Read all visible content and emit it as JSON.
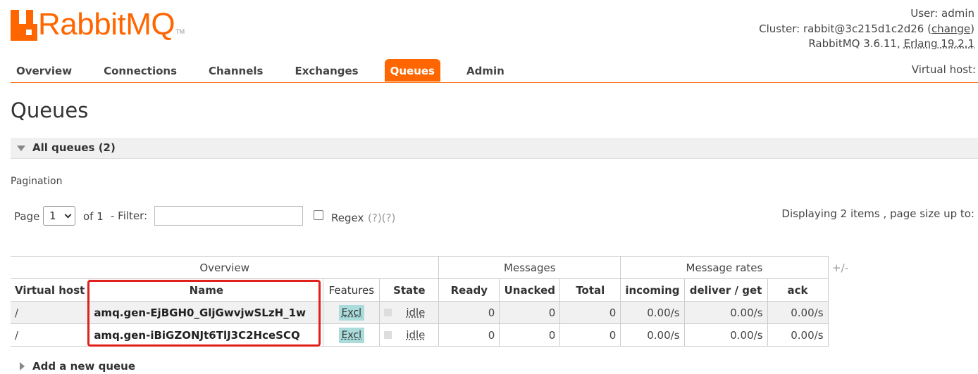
{
  "brand": {
    "name": "RabbitMQ",
    "tm": "TM",
    "color": "#ff6600"
  },
  "header": {
    "user_label": "User:",
    "user": "admin",
    "cluster_label": "Cluster:",
    "cluster": "rabbit@3c215d1c2d26",
    "change_link": "change",
    "version": "RabbitMQ 3.6.11,",
    "erlang": "Erlang 19.2.1"
  },
  "tabs": [
    {
      "label": "Overview",
      "active": false
    },
    {
      "label": "Connections",
      "active": false
    },
    {
      "label": "Channels",
      "active": false
    },
    {
      "label": "Exchanges",
      "active": false
    },
    {
      "label": "Queues",
      "active": true
    },
    {
      "label": "Admin",
      "active": false
    }
  ],
  "virtual_host_label": "Virtual host:",
  "page_title": "Queues",
  "section": {
    "label": "All queues (2)"
  },
  "pagination": {
    "label": "Pagination",
    "page_label": "Page",
    "page_value": "1",
    "of_label": "of 1",
    "filter_label": "- Filter:",
    "filter_value": "",
    "regex_label": "Regex",
    "regex_help": "(?)(?)",
    "displaying": "Displaying 2 items , page size up to:"
  },
  "table": {
    "groups": {
      "overview": "Overview",
      "messages": "Messages",
      "rates": "Message rates"
    },
    "columns": {
      "vhost": "Virtual host",
      "name": "Name",
      "features": "Features",
      "state": "State",
      "ready": "Ready",
      "unacked": "Unacked",
      "total": "Total",
      "incoming": "incoming",
      "deliver": "deliver / get",
      "ack": "ack"
    },
    "plus_minus": "+/-",
    "rows": [
      {
        "vhost": "/",
        "name": "amq.gen-EjBGH0_GljGwvjwSLzH_1w",
        "feature": "Excl",
        "state": "idle",
        "ready": "0",
        "unacked": "0",
        "total": "0",
        "incoming": "0.00/s",
        "deliver": "0.00/s",
        "ack": "0.00/s"
      },
      {
        "vhost": "/",
        "name": "amq.gen-iBiGZONJt6TlJ3C2HceSCQ",
        "feature": "Excl",
        "state": "idle",
        "ready": "0",
        "unacked": "0",
        "total": "0",
        "incoming": "0.00/s",
        "deliver": "0.00/s",
        "ack": "0.00/s"
      }
    ]
  },
  "add_section": {
    "label": "Add a new queue"
  },
  "colors": {
    "accent": "#ff6600",
    "highlight": "#e0201a",
    "feature_badge": "#aadcdc"
  }
}
